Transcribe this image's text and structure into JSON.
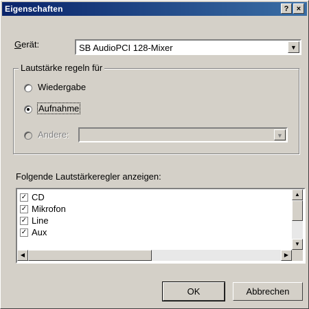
{
  "window": {
    "title": "Eigenschaften",
    "help_label": "?",
    "close_label": "×"
  },
  "device": {
    "label_prefix": "G",
    "label_rest": "erät:",
    "value": "SB AudioPCI 128-Mixer",
    "dropdown_icon": "chevron-down-icon"
  },
  "volume_group": {
    "legend": "Lautstärke regeln für",
    "options": [
      {
        "label": "Wiedergabe",
        "selected": false,
        "enabled": true
      },
      {
        "label": "Aufnahme",
        "selected": true,
        "enabled": true
      },
      {
        "label": "Andere:",
        "selected": false,
        "enabled": false
      }
    ],
    "other_value": ""
  },
  "controls_list": {
    "label": "Folgende Lautstärkeregler anzeigen:",
    "items": [
      {
        "label": "CD",
        "checked": true
      },
      {
        "label": "Mikrofon",
        "checked": true
      },
      {
        "label": "Line",
        "checked": true
      },
      {
        "label": "Aux",
        "checked": true
      }
    ]
  },
  "buttons": {
    "ok": "OK",
    "cancel": "Abbrechen"
  }
}
